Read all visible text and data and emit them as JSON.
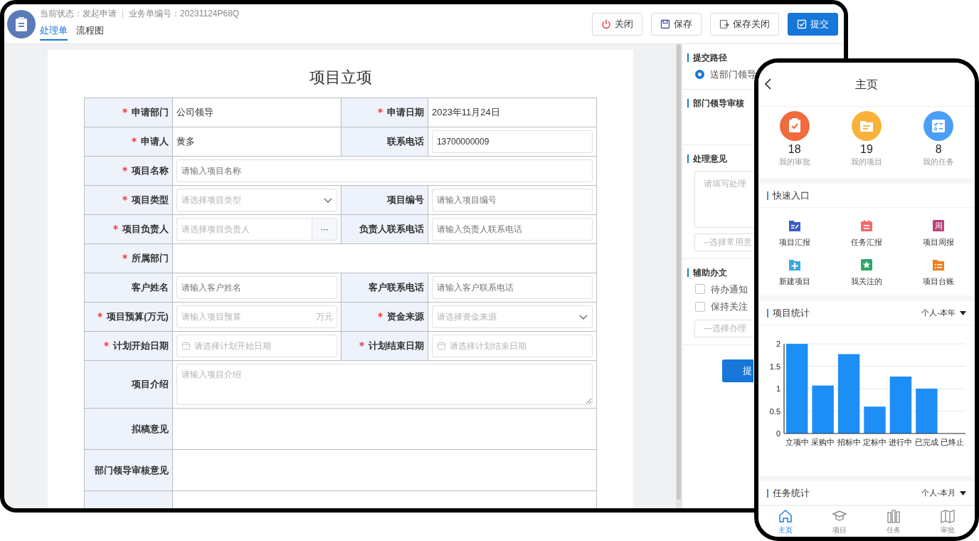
{
  "header": {
    "status_label": "当前状态：发起申请",
    "order_label": "业务单编号：20231124P68Q"
  },
  "tabs": [
    {
      "label": "处理单",
      "selected": true
    },
    {
      "label": "流程图",
      "selected": false
    }
  ],
  "actions": [
    {
      "label": "关闭",
      "kind": "close"
    },
    {
      "label": "保存",
      "kind": "save"
    },
    {
      "label": "保存关闭",
      "kind": "save_close"
    },
    {
      "label": "提交",
      "kind": "submit"
    }
  ],
  "form": {
    "title": "项目立项",
    "rows": [
      [
        {
          "label": "申请部门",
          "required": true,
          "kind": "text",
          "value": "公司领导"
        },
        {
          "label": "申请日期",
          "required": true,
          "kind": "text",
          "value": "2023年11月24日"
        }
      ],
      [
        {
          "label": "申请人",
          "required": true,
          "kind": "text",
          "value": "黄多"
        },
        {
          "label": "联系电话",
          "required": false,
          "kind": "input",
          "value": "13700000009"
        }
      ],
      [
        {
          "label": "项目名称",
          "required": true,
          "kind": "input",
          "placeholder": "请输入项目名称"
        }
      ],
      [
        {
          "label": "项目类型",
          "required": true,
          "kind": "select",
          "placeholder": "请选择项目类型"
        },
        {
          "label": "项目编号",
          "required": false,
          "kind": "input",
          "placeholder": "请输入项目编号"
        }
      ],
      [
        {
          "label": "项目负责人",
          "required": true,
          "kind": "picker",
          "placeholder": "请选择项目负责人",
          "button": "···"
        },
        {
          "label": "负责人联系电话",
          "required": false,
          "kind": "input",
          "placeholder": "请输入负责人联系电话"
        }
      ],
      [
        {
          "label": "所属部门",
          "required": true,
          "kind": "empty"
        }
      ],
      [
        {
          "label": "客户姓名",
          "required": false,
          "kind": "input",
          "placeholder": "请输入客户姓名"
        },
        {
          "label": "客户联系电话",
          "required": false,
          "kind": "input",
          "placeholder": "请输入客户联系电话"
        }
      ],
      [
        {
          "label": "项目预算(万元)",
          "required": true,
          "kind": "suffix",
          "placeholder": "请输入项目预算",
          "suffix": "万元"
        },
        {
          "label": "资金来源",
          "required": true,
          "kind": "select",
          "placeholder": "请选择资金来源"
        }
      ],
      [
        {
          "label": "计划开始日期",
          "required": true,
          "kind": "date",
          "placeholder": "请选择计划开始日期"
        },
        {
          "label": "计划结束日期",
          "required": true,
          "kind": "date",
          "placeholder": "请选择计划结束日期"
        }
      ],
      [
        {
          "label": "项目介绍",
          "required": false,
          "kind": "textarea",
          "placeholder": "请输入项目介绍"
        }
      ],
      [
        {
          "label": "拟稿意见",
          "required": false,
          "kind": "opinion"
        }
      ],
      [
        {
          "label": "部门领导审核意见",
          "required": false,
          "kind": "opinion"
        }
      ],
      [
        {
          "kind": "opinion"
        }
      ]
    ]
  },
  "side_panel": {
    "sections": [
      {
        "title": "提交路径",
        "kind": "radio",
        "options": [
          {
            "label": "送部门领导",
            "selected": true
          }
        ]
      },
      {
        "title": "部门领导审核",
        "kind": "empty"
      },
      {
        "title": "处理意见",
        "kind": "opinion",
        "placeholder": "请填写处理",
        "select_placeholder": "--选择常用意"
      },
      {
        "title": "辅助办文",
        "kind": "checks",
        "options": [
          {
            "label": "待办通知",
            "checked": false
          },
          {
            "label": "保持关注",
            "checked": false
          }
        ],
        "select_placeholder": "---选择办理"
      }
    ],
    "button": "提"
  },
  "phone": {
    "title": "主页",
    "stats": [
      {
        "value": "18",
        "label": "我的审批",
        "kind": "approval",
        "color": "#f06b3d"
      },
      {
        "value": "19",
        "label": "我的项目",
        "kind": "project",
        "color": "#f9b13a"
      },
      {
        "value": "8",
        "label": "我的任务",
        "kind": "task",
        "color": "#4a9ff5"
      }
    ],
    "quick_title": "快速入口",
    "quick": [
      {
        "label": "项目汇报",
        "kind": "report",
        "color": "#3b5fc7"
      },
      {
        "label": "任务汇报",
        "kind": "calendar",
        "color": "#f06b6b"
      },
      {
        "label": "项目周报",
        "kind": "text",
        "icon_text": "周",
        "color": "#b8427a"
      },
      {
        "label": "新建项目",
        "kind": "add",
        "color": "#3aa7e0"
      },
      {
        "label": "我关注的",
        "kind": "star",
        "color": "#2ea86a"
      },
      {
        "label": "项目台账",
        "kind": "list",
        "color": "#f08020"
      }
    ],
    "project_stats": {
      "title": "项目统计",
      "filter": "个人-本年",
      "chart_data": {
        "type": "bar",
        "categories": [
          "立项中",
          "采购中",
          "招标中",
          "定标中",
          "进行中",
          "已完成",
          "已终止"
        ],
        "grid": true,
        "series": [
          {
            "color": "#1e8ef7",
            "values": [
              2,
              1.07,
              1.77,
              0.6,
              1.27,
              1,
              0
            ]
          }
        ],
        "ylim": [
          0,
          2
        ],
        "yticks": [
          0,
          {
            "value": 0.5,
            "label": "0.5"
          },
          1,
          {
            "value": 1.5,
            "label": "1.5"
          },
          2
        ]
      }
    },
    "task_stats": {
      "title": "任务统计",
      "filter": "个人-本月"
    },
    "tabbar": [
      {
        "label": "主页",
        "kind": "home",
        "selected": true
      },
      {
        "label": "项目",
        "kind": "cap",
        "selected": false
      },
      {
        "label": "任务",
        "kind": "books",
        "selected": false
      },
      {
        "label": "审批",
        "kind": "map",
        "selected": false
      }
    ]
  }
}
